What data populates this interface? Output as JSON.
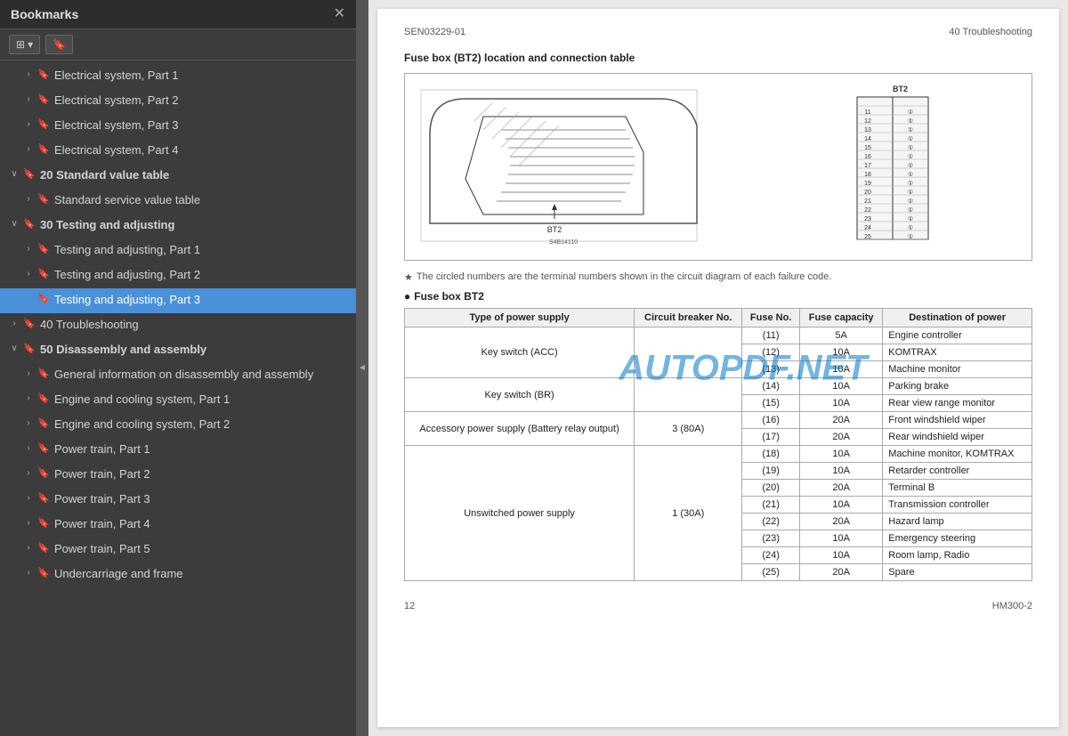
{
  "sidebar": {
    "title": "Bookmarks",
    "toolbar": {
      "view_btn": "☰▾",
      "bookmark_icon": "🔖"
    },
    "items": [
      {
        "id": "elec1",
        "level": 1,
        "toggle": "›",
        "label": "Electrical system, Part 1",
        "selected": false
      },
      {
        "id": "elec2",
        "level": 1,
        "toggle": "›",
        "label": "Electrical system, Part 2",
        "selected": false
      },
      {
        "id": "elec3",
        "level": 1,
        "toggle": "›",
        "label": "Electrical system, Part 3",
        "selected": false
      },
      {
        "id": "elec4",
        "level": 1,
        "toggle": "›",
        "label": "Electrical system, Part 4",
        "selected": false
      },
      {
        "id": "stdval",
        "level": 0,
        "toggle": "∨",
        "label": "20 Standard value table",
        "selected": false,
        "bold": true
      },
      {
        "id": "stdservice",
        "level": 1,
        "toggle": "›",
        "label": "Standard service value table",
        "selected": false
      },
      {
        "id": "testing",
        "level": 0,
        "toggle": "∨",
        "label": "30 Testing and adjusting",
        "selected": false,
        "bold": true
      },
      {
        "id": "testing1",
        "level": 1,
        "toggle": "›",
        "label": "Testing and adjusting, Part 1",
        "selected": false
      },
      {
        "id": "testing2",
        "level": 1,
        "toggle": "›",
        "label": "Testing and adjusting, Part 2",
        "selected": false
      },
      {
        "id": "testing3",
        "level": 1,
        "toggle": "",
        "label": "Testing and adjusting, Part 3",
        "selected": true
      },
      {
        "id": "trouble",
        "level": 0,
        "toggle": "›",
        "label": "40 Troubleshooting",
        "selected": false,
        "bold": false
      },
      {
        "id": "disassembly",
        "level": 0,
        "toggle": "∨",
        "label": "50 Disassembly and assembly",
        "selected": false,
        "bold": true
      },
      {
        "id": "general",
        "level": 1,
        "toggle": "›",
        "label": "General information on disassembly and assembly",
        "selected": false
      },
      {
        "id": "engine1",
        "level": 1,
        "toggle": "›",
        "label": "Engine and cooling system, Part 1",
        "selected": false
      },
      {
        "id": "engine2",
        "level": 1,
        "toggle": "›",
        "label": "Engine and cooling system, Part 2",
        "selected": false
      },
      {
        "id": "power1",
        "level": 1,
        "toggle": "›",
        "label": "Power train, Part 1",
        "selected": false
      },
      {
        "id": "power2",
        "level": 1,
        "toggle": "›",
        "label": "Power train, Part 2",
        "selected": false
      },
      {
        "id": "power3",
        "level": 1,
        "toggle": "›",
        "label": "Power train, Part 3",
        "selected": false
      },
      {
        "id": "power4",
        "level": 1,
        "toggle": "›",
        "label": "Power train, Part 4",
        "selected": false
      },
      {
        "id": "power5",
        "level": 1,
        "toggle": "›",
        "label": "Power train, Part 5",
        "selected": false
      },
      {
        "id": "undercarriage",
        "level": 1,
        "toggle": "›",
        "label": "Undercarriage and frame",
        "selected": false
      }
    ]
  },
  "document": {
    "header_left": "SEN03229-01",
    "header_right": "40 Troubleshooting",
    "section_title": "Fuse box (BT2) location and connection table",
    "note_star": "The circled numbers are the terminal numbers shown in the circuit diagram of each failure code.",
    "bullet_label": "Fuse box BT2",
    "watermark": "AUTOPDF.NET",
    "table": {
      "headers": [
        "Type of power supply",
        "Circuit breaker No.",
        "Fuse No.",
        "Fuse capacity",
        "Destination of power"
      ],
      "rows": [
        {
          "power": "Key switch (ACC)",
          "breaker": "",
          "fuse_no": "(11)",
          "fuse_cap": "5A",
          "dest": "Engine controller"
        },
        {
          "power": "",
          "breaker": "",
          "fuse_no": "(12)",
          "fuse_cap": "10A",
          "dest": "KOMTRAX"
        },
        {
          "power": "",
          "breaker": "",
          "fuse_no": "(13)",
          "fuse_cap": "10A",
          "dest": "Machine monitor"
        },
        {
          "power": "Key switch (BR)",
          "breaker": "",
          "fuse_no": "(14)",
          "fuse_cap": "10A",
          "dest": "Parking brake"
        },
        {
          "power": "",
          "breaker": "",
          "fuse_no": "(15)",
          "fuse_cap": "10A",
          "dest": "Rear view range monitor"
        },
        {
          "power": "Accessory power supply (Battery relay output)",
          "breaker": "3 (80A)",
          "fuse_no": "(16)",
          "fuse_cap": "20A",
          "dest": "Front windshield wiper"
        },
        {
          "power": "",
          "breaker": "",
          "fuse_no": "(17)",
          "fuse_cap": "20A",
          "dest": "Rear windshield wiper"
        },
        {
          "power": "",
          "breaker": "",
          "fuse_no": "(18)",
          "fuse_cap": "10A",
          "dest": "Machine monitor, KOMTRAX"
        },
        {
          "power": "",
          "breaker": "",
          "fuse_no": "(19)",
          "fuse_cap": "10A",
          "dest": "Retarder controller"
        },
        {
          "power": "Unswitched power supply",
          "breaker": "1 (30A)",
          "fuse_no": "(20)",
          "fuse_cap": "20A",
          "dest": "Terminal B"
        },
        {
          "power": "",
          "breaker": "",
          "fuse_no": "(21)",
          "fuse_cap": "10A",
          "dest": "Transmission controller"
        },
        {
          "power": "",
          "breaker": "",
          "fuse_no": "(22)",
          "fuse_cap": "20A",
          "dest": "Hazard lamp"
        },
        {
          "power": "",
          "breaker": "",
          "fuse_no": "(23)",
          "fuse_cap": "10A",
          "dest": "Emergency steering"
        },
        {
          "power": "",
          "breaker": "",
          "fuse_no": "(24)",
          "fuse_cap": "10A",
          "dest": "Room lamp, Radio"
        },
        {
          "power": "",
          "breaker": "",
          "fuse_no": "(25)",
          "fuse_cap": "20A",
          "dest": "Spare"
        }
      ]
    },
    "page_num": "12",
    "page_code": "HM300-2"
  }
}
